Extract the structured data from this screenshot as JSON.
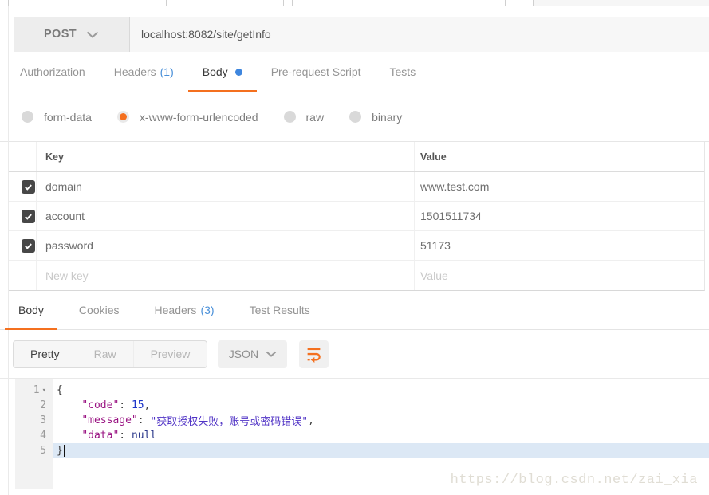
{
  "request": {
    "method": "POST",
    "url": "localhost:8082/site/getInfo",
    "tabs": [
      {
        "label": "Authorization"
      },
      {
        "label": "Headers",
        "count": "(1)"
      },
      {
        "label": "Body",
        "active": true,
        "dot": true
      },
      {
        "label": "Pre-request Script"
      },
      {
        "label": "Tests"
      }
    ],
    "body_modes": [
      {
        "label": "form-data",
        "selected": false
      },
      {
        "label": "x-www-form-urlencoded",
        "selected": true
      },
      {
        "label": "raw",
        "selected": false
      },
      {
        "label": "binary",
        "selected": false
      }
    ],
    "params_table": {
      "columns": [
        "Key",
        "Value"
      ],
      "rows": [
        {
          "key": "domain",
          "value": "www.test.com",
          "checked": true
        },
        {
          "key": "account",
          "value": "1501511734",
          "checked": true
        },
        {
          "key": "password",
          "value": "51173",
          "checked": true
        }
      ],
      "new_row": {
        "key_placeholder": "New key",
        "value_placeholder": "Value"
      }
    }
  },
  "response": {
    "tabs": [
      {
        "label": "Body",
        "active": true
      },
      {
        "label": "Cookies"
      },
      {
        "label": "Headers",
        "count": "(3)"
      },
      {
        "label": "Test Results"
      }
    ],
    "view_modes": [
      {
        "label": "Pretty",
        "active": true
      },
      {
        "label": "Raw",
        "active": false
      },
      {
        "label": "Preview",
        "active": false
      }
    ],
    "format": "JSON",
    "code_lines": [
      {
        "num": "1",
        "fold": true,
        "tokens": [
          [
            "p",
            "{"
          ]
        ]
      },
      {
        "num": "2",
        "tokens": [
          [
            "p",
            "    "
          ],
          [
            "k",
            "\"code\""
          ],
          [
            "p",
            ": "
          ],
          [
            "n",
            "15"
          ],
          [
            "p",
            ","
          ]
        ]
      },
      {
        "num": "3",
        "tokens": [
          [
            "p",
            "    "
          ],
          [
            "k",
            "\"message\""
          ],
          [
            "p",
            ": "
          ],
          [
            "s",
            "\"获取授权失败，账号或密码错误\""
          ],
          [
            "p",
            ","
          ]
        ]
      },
      {
        "num": "4",
        "tokens": [
          [
            "p",
            "    "
          ],
          [
            "k",
            "\"data\""
          ],
          [
            "p",
            ": "
          ],
          [
            "a",
            "null"
          ]
        ]
      },
      {
        "num": "5",
        "highlight": true,
        "cursor": true,
        "tokens": [
          [
            "p",
            "}"
          ]
        ]
      }
    ]
  },
  "watermark": "https://blog.csdn.net/zai_xia",
  "colors": {
    "accent_orange": "#f4701f",
    "link_blue": "#4a90d9",
    "highlight_line": "#dce8f5"
  }
}
